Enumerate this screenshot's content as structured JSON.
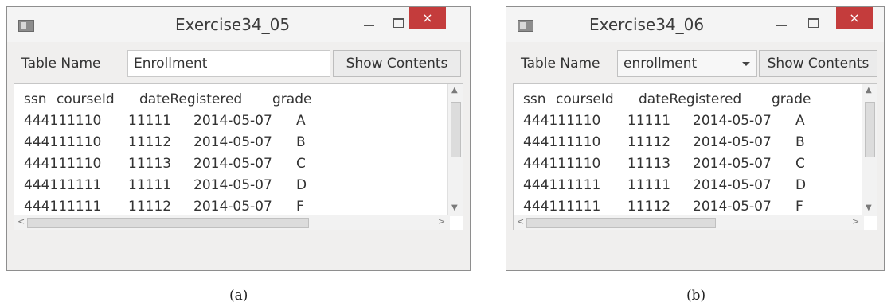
{
  "figure_a": {
    "window": {
      "title": "Exercise34_05",
      "minimize_icon": "minimize-icon",
      "maximize_icon": "maximize-icon",
      "close_glyph": "×"
    },
    "toolbar": {
      "table_name_label": "Table Name",
      "table_name_value": "Enrollment",
      "show_button": "Show Contents"
    },
    "contents": {
      "header": [
        "ssn",
        "courseId",
        "dateRegistered",
        "grade"
      ],
      "rows": [
        [
          "444111110",
          "11111",
          "2014-05-07",
          "A"
        ],
        [
          "444111110",
          "11112",
          "2014-05-07",
          "B"
        ],
        [
          "444111110",
          "11113",
          "2014-05-07",
          "C"
        ],
        [
          "444111111",
          "11111",
          "2014-05-07",
          "D"
        ],
        [
          "444111111",
          "11112",
          "2014-05-07",
          "F"
        ]
      ]
    },
    "caption": "(a)"
  },
  "figure_b": {
    "window": {
      "title": "Exercise34_06",
      "minimize_icon": "minimize-icon",
      "maximize_icon": "maximize-icon",
      "close_glyph": "×"
    },
    "toolbar": {
      "table_name_label": "Table Name",
      "table_name_selected": "enrollment",
      "show_button": "Show Contents"
    },
    "contents": {
      "header": [
        "ssn",
        "courseId",
        "dateRegistered",
        "grade"
      ],
      "rows": [
        [
          "444111110",
          "11111",
          "2014-05-07",
          "A"
        ],
        [
          "444111110",
          "11112",
          "2014-05-07",
          "B"
        ],
        [
          "444111110",
          "11113",
          "2014-05-07",
          "C"
        ],
        [
          "444111111",
          "11111",
          "2014-05-07",
          "D"
        ],
        [
          "444111111",
          "11112",
          "2014-05-07",
          "F"
        ]
      ]
    },
    "caption": "(b)"
  },
  "colors": {
    "close_button": "#c43c3c",
    "window_bg": "#f0efee",
    "text": "#333333"
  }
}
